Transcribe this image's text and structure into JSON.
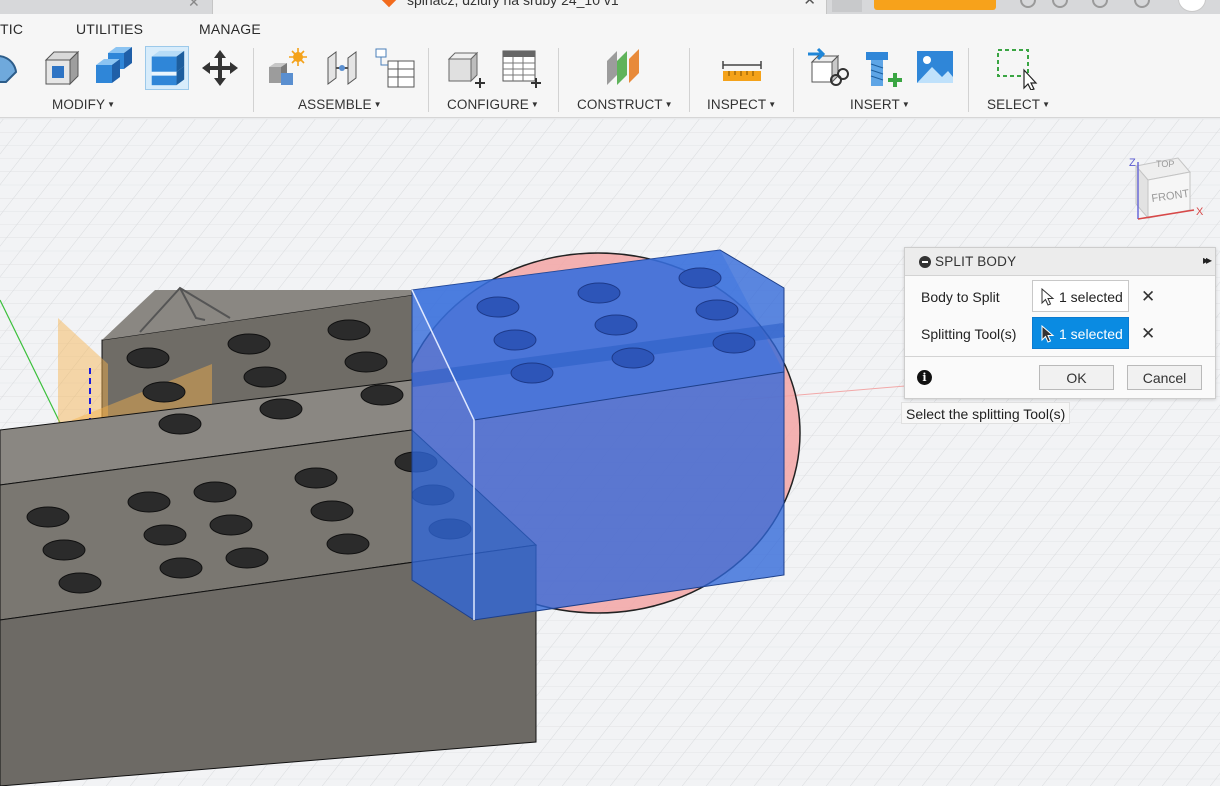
{
  "titlebar": {
    "document_title": "spinacz, dziury na sruby 24_10 v1",
    "close_symbol": "✕"
  },
  "menu_tabs": [
    "TIC",
    "UTILITIES",
    "MANAGE"
  ],
  "toolbar": {
    "groups": [
      {
        "label": "MODIFY"
      },
      {
        "label": "ASSEMBLE"
      },
      {
        "label": "CONFIGURE"
      },
      {
        "label": "CONSTRUCT"
      },
      {
        "label": "INSPECT"
      },
      {
        "label": "INSERT"
      },
      {
        "label": "SELECT"
      }
    ],
    "caret": "▼",
    "icons": {
      "modify": [
        "press-pull-icon",
        "fillet-icon",
        "shell-icon",
        "combine-icon",
        "split-body-icon",
        "move-icon"
      ],
      "assemble": [
        "new-component-icon",
        "joint-icon",
        "component-table-icon"
      ],
      "configure": [
        "configure-icon",
        "configure-table-icon"
      ],
      "construct": [
        "offset-plane-icon"
      ],
      "inspect": [
        "measure-icon"
      ],
      "insert": [
        "insert-derive-icon",
        "insert-mcmaster-icon",
        "insert-canvas-icon"
      ],
      "select": [
        "window-select-icon"
      ]
    }
  },
  "viewcube": {
    "top": "TOP",
    "front": "FRONT",
    "axis_z": "Z",
    "axis_x": "X"
  },
  "dialog": {
    "title": "SPLIT BODY",
    "expand_symbol": "▸▸",
    "body_to_split": {
      "label": "Body to Split",
      "value": "1 selected"
    },
    "splitting_tool": {
      "label": "Splitting Tool(s)",
      "value": "1 selected"
    },
    "clear_symbol": "✕",
    "info_symbol": "i",
    "ok": "OK",
    "cancel": "Cancel"
  },
  "tooltip": "Select the splitting Tool(s)",
  "colors": {
    "accent_blue": "#0a8be2",
    "split_tool_blue": "#2f66d8",
    "split_circle_red": "#e25a5a",
    "body_gray": "#6f6c66",
    "brand_orange": "#f26b1d"
  }
}
